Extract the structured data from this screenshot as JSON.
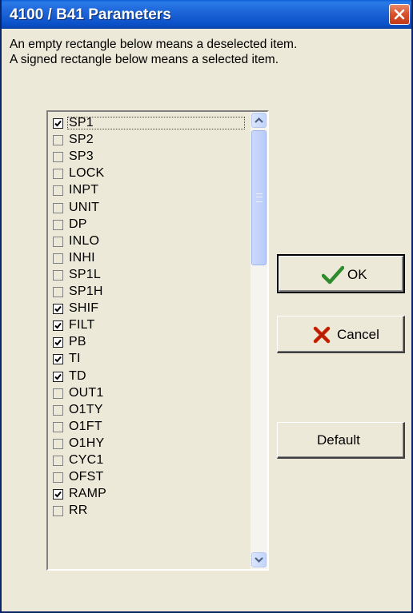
{
  "window": {
    "title": "4100 / B41 Parameters"
  },
  "info": {
    "line1": "An empty rectangle below means a deselected item.",
    "line2": "A signed rectangle below means a selected item."
  },
  "items": [
    {
      "label": "SP1",
      "checked": true
    },
    {
      "label": "SP2",
      "checked": false
    },
    {
      "label": "SP3",
      "checked": false
    },
    {
      "label": "LOCK",
      "checked": false
    },
    {
      "label": "INPT",
      "checked": false
    },
    {
      "label": "UNIT",
      "checked": false
    },
    {
      "label": "DP",
      "checked": false
    },
    {
      "label": "INLO",
      "checked": false
    },
    {
      "label": "INHI",
      "checked": false
    },
    {
      "label": "SP1L",
      "checked": false
    },
    {
      "label": "SP1H",
      "checked": false
    },
    {
      "label": "SHIF",
      "checked": true
    },
    {
      "label": "FILT",
      "checked": true
    },
    {
      "label": "PB",
      "checked": true
    },
    {
      "label": "TI",
      "checked": true
    },
    {
      "label": "TD",
      "checked": true
    },
    {
      "label": "OUT1",
      "checked": false
    },
    {
      "label": "O1TY",
      "checked": false
    },
    {
      "label": "O1FT",
      "checked": false
    },
    {
      "label": "O1HY",
      "checked": false
    },
    {
      "label": "CYC1",
      "checked": false
    },
    {
      "label": "OFST",
      "checked": false
    },
    {
      "label": "RAMP",
      "checked": true
    },
    {
      "label": "RR",
      "checked": false
    }
  ],
  "buttons": {
    "ok_label": "OK",
    "cancel_label": "Cancel",
    "default_label": "Default"
  },
  "colors": {
    "titlebar": "#0a5fd8",
    "ok_check": "#2e8b2e",
    "cancel_x": "#cc2200"
  },
  "icons": {
    "close": "close-icon",
    "ok": "checkmark-icon",
    "cancel": "x-icon"
  }
}
